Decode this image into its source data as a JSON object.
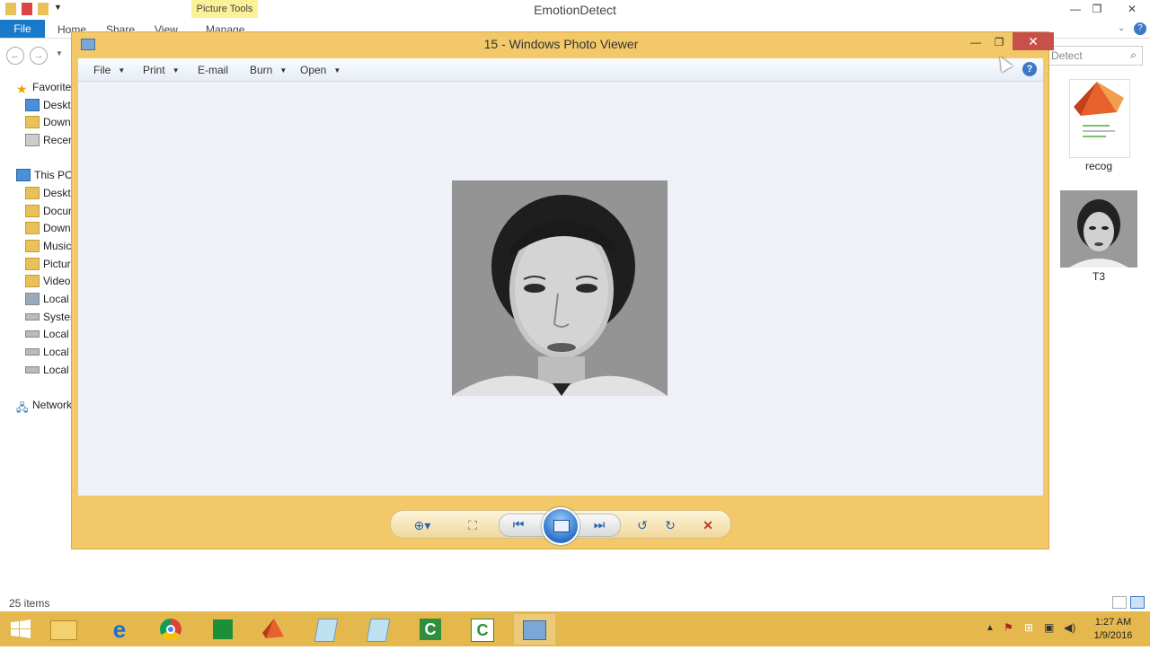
{
  "explorer": {
    "title": "EmotionDetect",
    "picture_tools": "Picture Tools",
    "ribbon": {
      "file": "File",
      "tabs": [
        "Home",
        "Share",
        "View",
        "Manage"
      ]
    },
    "search_placeholder": "Detect",
    "nav_tree": [
      {
        "label": "Favorites",
        "icon": "star-icon"
      },
      {
        "label": "Deskto",
        "icon": "desktop-icon"
      },
      {
        "label": "Downl",
        "icon": "downloads-icon"
      },
      {
        "label": "Recent",
        "icon": "recent-icon"
      },
      {
        "label": "This PC",
        "icon": "pc-icon"
      },
      {
        "label": "Deskto",
        "icon": "desktop-icon"
      },
      {
        "label": "Docun",
        "icon": "documents-icon"
      },
      {
        "label": "Downl",
        "icon": "downloads-icon"
      },
      {
        "label": "Music",
        "icon": "music-icon"
      },
      {
        "label": "Picture",
        "icon": "pictures-icon"
      },
      {
        "label": "Videos",
        "icon": "videos-icon"
      },
      {
        "label": "Local D",
        "icon": "drive-icon"
      },
      {
        "label": "System",
        "icon": "drive-icon"
      },
      {
        "label": "Local D",
        "icon": "drive-icon"
      },
      {
        "label": "Local D",
        "icon": "drive-icon"
      },
      {
        "label": "Local D",
        "icon": "drive-icon"
      },
      {
        "label": "Network",
        "icon": "network-icon"
      }
    ],
    "files": [
      {
        "name": "recog",
        "icon": "matlab-file-icon"
      },
      {
        "name": "T3",
        "icon": "face-image-thumbnail"
      }
    ],
    "status": "25 items"
  },
  "photo_viewer": {
    "title": "15 - Windows Photo Viewer",
    "menu": [
      "File",
      "Print",
      "E-mail",
      "Burn",
      "Open"
    ],
    "help": "?",
    "image": "grayscale face photo"
  },
  "taskbar": {
    "apps": [
      "start-icon",
      "file-explorer-icon",
      "internet-explorer-icon",
      "chrome-icon",
      "green-app-icon",
      "matlab-icon",
      "notepad-icon",
      "notepad-icon-2",
      "camtasia-icon",
      "camtasia-icon-2",
      "photo-viewer-icon"
    ],
    "time": "1:27 AM",
    "date": "1/9/2016"
  }
}
